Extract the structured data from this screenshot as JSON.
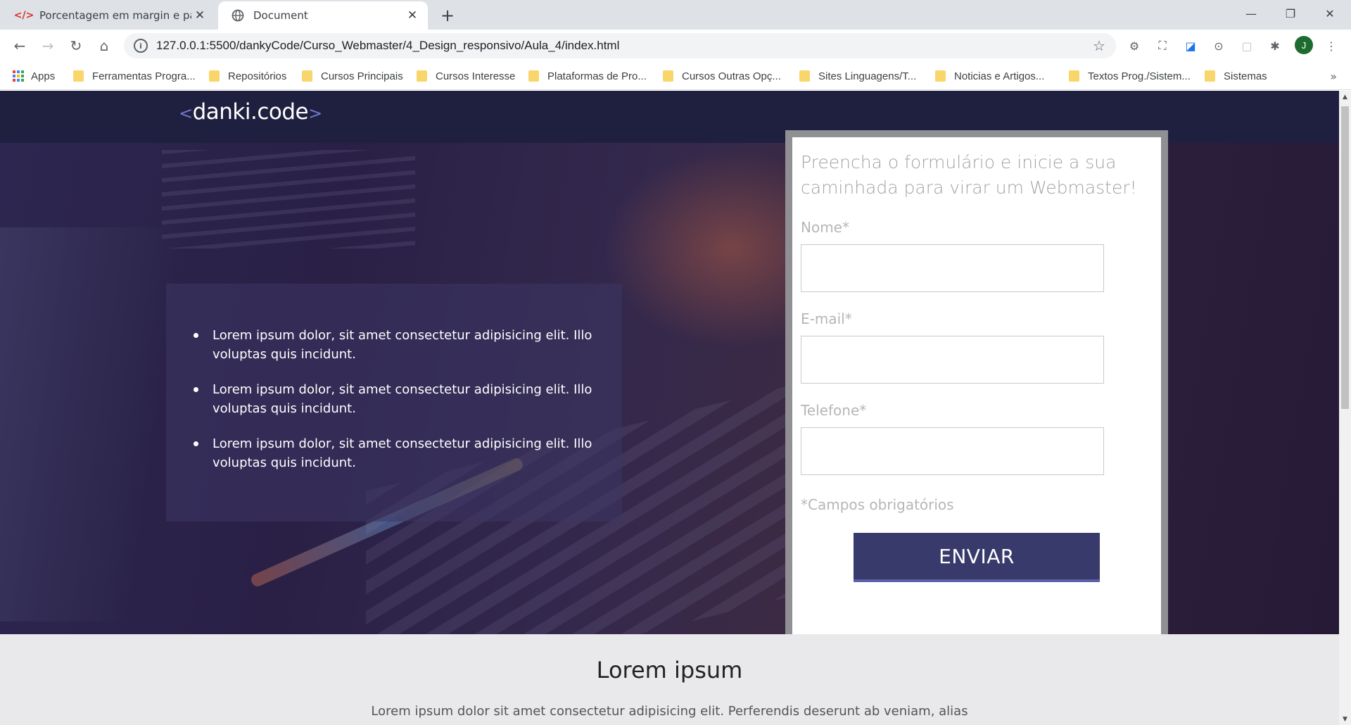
{
  "browser": {
    "tabs": [
      {
        "title": "Porcentagem em margin e paddi",
        "favicon": "code-icon",
        "active": false
      },
      {
        "title": "Document",
        "favicon": "globe-icon",
        "active": true
      }
    ],
    "new_tab": "+",
    "address": "127.0.0.1:5500/dankyCode/Curso_Webmaster/4_Design_responsivo/Aula_4/index.html",
    "profile_initial": "J",
    "bookmarks": [
      "Apps",
      "Ferramentas Progra...",
      "Repositórios",
      "Cursos Principais",
      "Cursos Interesse",
      "Plataformas de Pro...",
      "Cursos Outras Opç...",
      "Sites Linguagens/T...",
      "Noticias e Artigos...",
      "Textos Prog./Sistem...",
      "Sistemas"
    ],
    "bookmarks_more": "»"
  },
  "site": {
    "logo": {
      "left": "<",
      "text": "danki.code",
      "right": ">"
    },
    "features": [
      "Lorem ipsum dolor, sit amet consectetur adipisicing elit. Illo voluptas quis incidunt.",
      "Lorem ipsum dolor, sit amet consectetur adipisicing elit. Illo voluptas quis incidunt.",
      "Lorem ipsum dolor, sit amet consectetur adipisicing elit. Illo voluptas quis incidunt."
    ],
    "form": {
      "heading": "Preencha o formulário e inicie a sua caminhada para virar um Webmaster!",
      "fields": [
        {
          "label": "Nome*",
          "value": ""
        },
        {
          "label": "E-mail*",
          "value": ""
        },
        {
          "label": "Telefone*",
          "value": ""
        }
      ],
      "note": "*Campos obrigatórios",
      "submit": "ENVIAR"
    },
    "section": {
      "title": "Lorem ipsum",
      "text": "Lorem ipsum dolor sit amet consectetur adipisicing elit. Perferendis deserunt ab veniam, alias"
    }
  },
  "colors": {
    "header_bg": "#1f2040",
    "button_bg": "#383a6b",
    "form_border": "#8f8f94"
  }
}
